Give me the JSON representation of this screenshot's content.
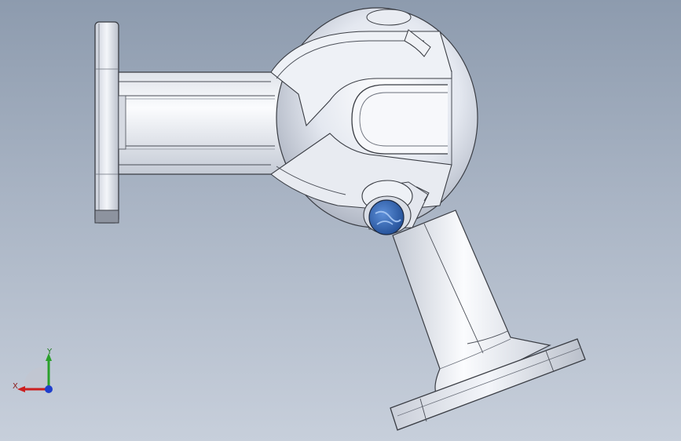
{
  "viewport": {
    "background_top": "#8d9bae",
    "background_bottom": "#c7cfdb"
  },
  "model": {
    "description_icon": "pipe-elbow-assembly",
    "part_color": "#e6e9f0",
    "edge_color": "#3a3d44",
    "cap_color": "#2f63b4"
  },
  "triad": {
    "x_label": "X",
    "y_label": "Y",
    "x_color": "#cc1f1f",
    "y_color": "#2aa02a",
    "z_color": "#1f3fcc"
  }
}
